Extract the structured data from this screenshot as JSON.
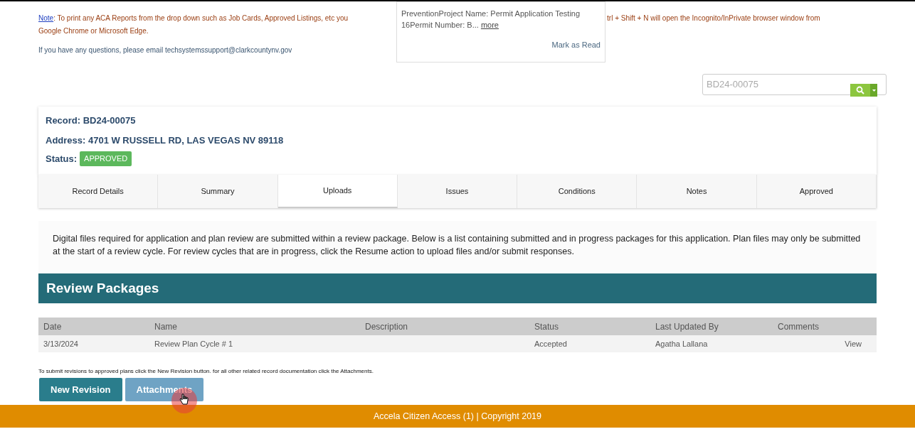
{
  "notice": {
    "link": "Note",
    "text_left": ": To print any ACA Reports from the drop down such as Job Cards, Approved Listings, etc you",
    "text_right": "trl + Shift + N will open the Incognito/InPrivate browser window from",
    "line2": "Google Chrome or Microsoft Edge.",
    "contact": "If you have any questions, please email techsystemssupport@clarkcountynv.gov"
  },
  "popup": {
    "text": "PreventionProject Name: Permit Application Testing 16Permit Number: B...",
    "more": "more",
    "mark_read": "Mark as Read"
  },
  "search": {
    "value": "BD24-00075"
  },
  "record": {
    "record": "Record: BD24-00075",
    "address": "Address: 4701 W RUSSELL RD, LAS VEGAS NV 89118",
    "status_label": "Status:",
    "status": "APPROVED"
  },
  "tabs": [
    {
      "label": "Record Details",
      "selected": false
    },
    {
      "label": "Summary",
      "selected": false
    },
    {
      "label": "Uploads",
      "selected": true
    },
    {
      "label": "Issues",
      "selected": false
    },
    {
      "label": "Conditions",
      "selected": false
    },
    {
      "label": "Notes",
      "selected": false
    },
    {
      "label": "Approved",
      "selected": false
    }
  ],
  "intro": "Digital files required for application and plan review are submitted within a review package. Below is a list containing submitted and in progress packages for this application. Plan files may only be submitted at the start of a review cycle. For review cycles that are in progress, click the Resume action to upload files and/or submit responses.",
  "packages": {
    "title": "Review Packages",
    "columns": [
      "Date",
      "Name",
      "Description",
      "Status",
      "Last Updated By",
      "Comments"
    ],
    "rows": [
      {
        "date": "3/13/2024",
        "name": "Review Plan Cycle # 1",
        "description": "",
        "status": "Accepted",
        "updated_by": "Agatha Lallana",
        "comments": "View"
      }
    ]
  },
  "hint": "To submit revisions to approved plans click the New Revision button. for all other related record documentation click the Attachments.",
  "buttons": [
    {
      "label": "New Revision",
      "kind": "primary"
    },
    {
      "label": "Attachments",
      "kind": "secondary"
    }
  ],
  "footer": "Accela Citizen Access (1) | Copyright 2019"
}
